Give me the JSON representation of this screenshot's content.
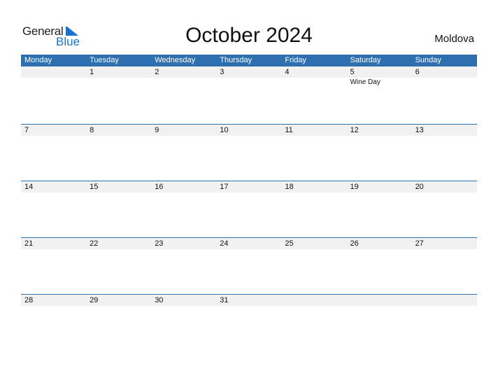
{
  "logo": {
    "general": "General",
    "blue": "Blue"
  },
  "title": "October 2024",
  "country": "Moldova",
  "colors": {
    "accent": "#2e6fb0",
    "strip": "#f1f1f1"
  },
  "weekdays": [
    "Monday",
    "Tuesday",
    "Wednesday",
    "Thursday",
    "Friday",
    "Saturday",
    "Sunday"
  ],
  "weeks": [
    [
      {
        "day": ""
      },
      {
        "day": "1"
      },
      {
        "day": "2"
      },
      {
        "day": "3"
      },
      {
        "day": "4"
      },
      {
        "day": "5",
        "event": "Wine Day"
      },
      {
        "day": "6"
      }
    ],
    [
      {
        "day": "7"
      },
      {
        "day": "8"
      },
      {
        "day": "9"
      },
      {
        "day": "10"
      },
      {
        "day": "11"
      },
      {
        "day": "12"
      },
      {
        "day": "13"
      }
    ],
    [
      {
        "day": "14"
      },
      {
        "day": "15"
      },
      {
        "day": "16"
      },
      {
        "day": "17"
      },
      {
        "day": "18"
      },
      {
        "day": "19"
      },
      {
        "day": "20"
      }
    ],
    [
      {
        "day": "21"
      },
      {
        "day": "22"
      },
      {
        "day": "23"
      },
      {
        "day": "24"
      },
      {
        "day": "25"
      },
      {
        "day": "26"
      },
      {
        "day": "27"
      }
    ],
    [
      {
        "day": "28"
      },
      {
        "day": "29"
      },
      {
        "day": "30"
      },
      {
        "day": "31"
      },
      {
        "day": ""
      },
      {
        "day": ""
      },
      {
        "day": ""
      }
    ]
  ]
}
